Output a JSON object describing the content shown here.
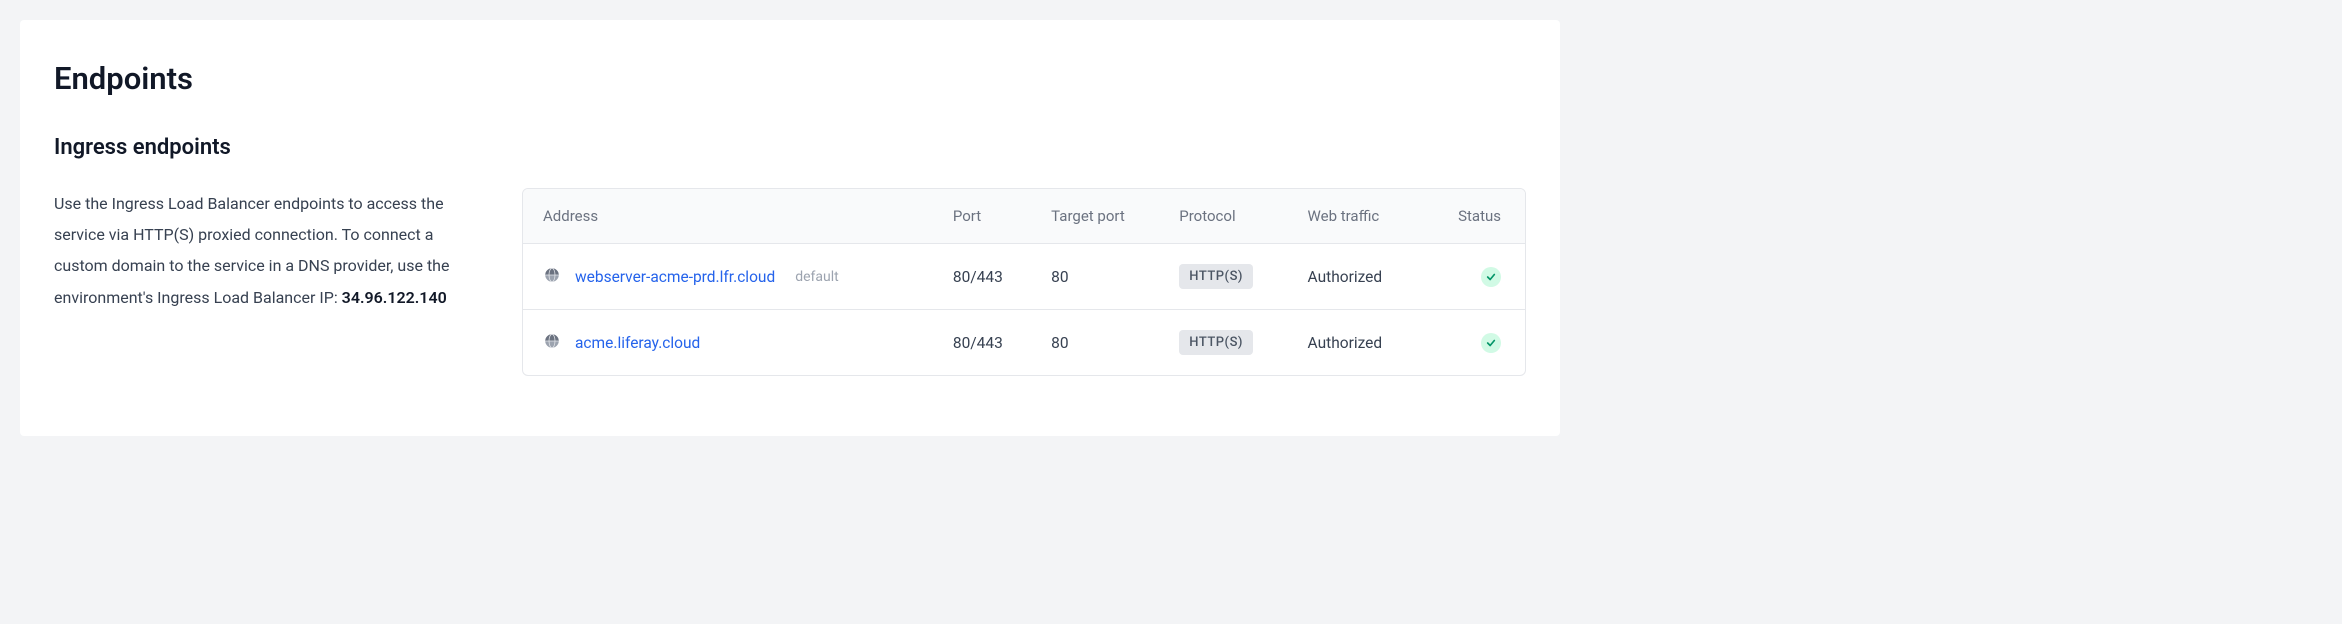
{
  "page": {
    "title": "Endpoints"
  },
  "section": {
    "title": "Ingress endpoints",
    "description_prefix": "Use the Ingress Load Balancer endpoints to access the service via HTTP(S) proxied connection. To connect a custom domain to the service in a DNS provider, use the environment's Ingress Load Balancer IP: ",
    "ip": "34.96.122.140"
  },
  "table": {
    "headers": {
      "address": "Address",
      "port": "Port",
      "target_port": "Target port",
      "protocol": "Protocol",
      "web_traffic": "Web traffic",
      "status": "Status"
    },
    "rows": [
      {
        "address": "webserver-acme-prd.lfr.cloud",
        "default_tag": "default",
        "port": "80/443",
        "target_port": "80",
        "protocol": "HTTP(S)",
        "web_traffic": "Authorized",
        "status": "ok"
      },
      {
        "address": "acme.liferay.cloud",
        "default_tag": "",
        "port": "80/443",
        "target_port": "80",
        "protocol": "HTTP(S)",
        "web_traffic": "Authorized",
        "status": "ok"
      }
    ]
  }
}
